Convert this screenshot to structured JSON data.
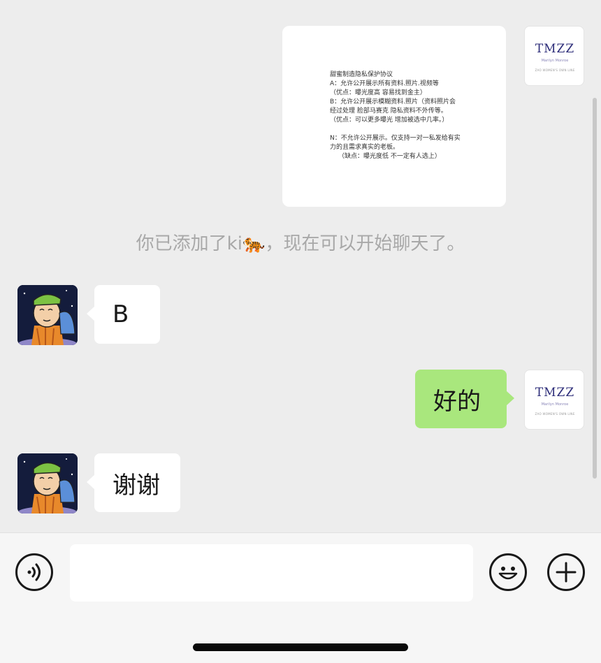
{
  "messages": {
    "image_doc": {
      "lines": [
        "甜蜜制造隐私保护协议",
        "A：允许公开展示所有资料.照片.视频等",
        "（优点：曝光度高 容易找到金主）",
        "B：允许公开展示模糊资料.照片（资料照片会",
        "经过处理 脸部马赛克 隐私资料不外传等。",
        "（优点：可以更多曝光 增加被选中几率。）",
        "",
        "N：不允许公开展示。仅支持一对一私发给有实",
        "力的且需求真实的老板。",
        "（缺点：曝光度低 不一定有人选上）"
      ]
    },
    "system_note": "你已添加了ki🐅，现在可以开始聊天了。",
    "reply_b": "B",
    "reply_ok": "好的",
    "reply_thanks": "谢谢"
  },
  "self_avatar": {
    "logo": "TMZZ",
    "sub": "Marilyn Monroe",
    "tagline": "ZAO WOMEN'S OWN LINE"
  },
  "colors": {
    "background": "#ededed",
    "own_bubble": "#a9e77d",
    "other_bubble": "#ffffff",
    "system_text": "#a8a8a8"
  },
  "input_bar": {
    "voice_icon": "voice-icon",
    "emoji_icon": "emoji-icon",
    "plus_icon": "plus-icon",
    "value": ""
  }
}
